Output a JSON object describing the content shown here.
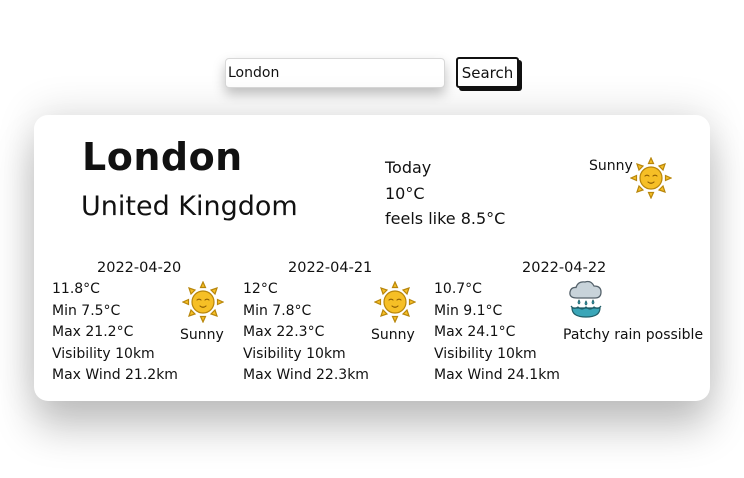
{
  "search": {
    "value": "London",
    "placeholder": "",
    "button_label": "Search"
  },
  "location": {
    "city": "London",
    "country": "United Kingdom"
  },
  "current": {
    "label": "Today",
    "temp": "10°C",
    "feels_like": "feels like 8.5°C",
    "condition": "Sunny",
    "icon": "sunny-icon"
  },
  "forecast": [
    {
      "date": "2022-04-20",
      "avg": "11.8°C",
      "min": "Min 7.5°C",
      "max": "Max 21.2°C",
      "visibility": "Visibility 10km",
      "wind": "Max Wind 21.2km",
      "condition": "Sunny",
      "icon": "sunny-icon"
    },
    {
      "date": "2022-04-21",
      "avg": "12°C",
      "min": "Min 7.8°C",
      "max": "Max 22.3°C",
      "visibility": "Visibility 10km",
      "wind": "Max Wind 22.3km",
      "condition": "Sunny",
      "icon": "sunny-icon"
    },
    {
      "date": "2022-04-22",
      "avg": "10.7°C",
      "min": "Min 9.1°C",
      "max": "Max 24.1°C",
      "visibility": "Visibility 10km",
      "wind": "Max Wind 24.1km",
      "condition": "Patchy rain possible",
      "icon": "patchy-rain-icon"
    }
  ],
  "colors": {
    "sun": "#f6bf26",
    "sun_outline": "#b8860b",
    "cloud": "#c8d3da",
    "rain": "#3aa6b8"
  }
}
